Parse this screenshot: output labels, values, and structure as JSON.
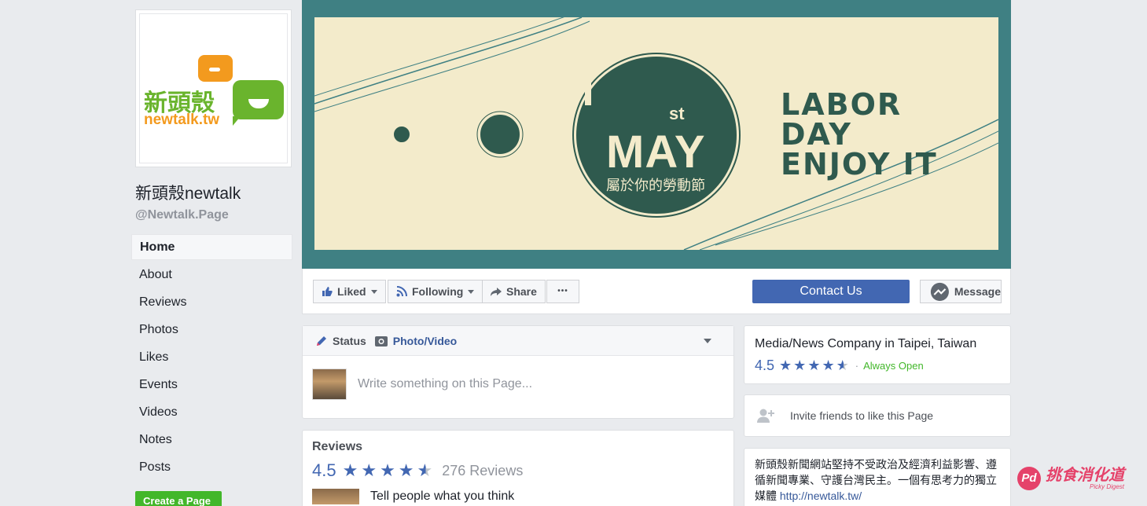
{
  "page": {
    "name": "新頭殼newtalk",
    "handle": "@Newtalk.Page",
    "logo_zh": "新頭殼",
    "logo_en": "newtalk.tw"
  },
  "nav": {
    "items": [
      {
        "label": "Home"
      },
      {
        "label": "About"
      },
      {
        "label": "Reviews"
      },
      {
        "label": "Photos"
      },
      {
        "label": "Likes"
      },
      {
        "label": "Events"
      },
      {
        "label": "Videos"
      },
      {
        "label": "Notes"
      },
      {
        "label": "Posts"
      }
    ],
    "create_page": "Create a Page"
  },
  "cover": {
    "st": "st",
    "may": "MAY",
    "zh": "屬於你的勞動節",
    "line1": "LABOR",
    "line2": "DAY",
    "line3": "ENJOY IT"
  },
  "actions": {
    "liked": "Liked",
    "following": "Following",
    "share": "Share",
    "more": "•••",
    "contact": "Contact Us",
    "message": "Message"
  },
  "composer": {
    "status": "Status",
    "photo": "Photo/Video",
    "placeholder": "Write something on this Page..."
  },
  "reviews": {
    "title": "Reviews",
    "rating": "4.5",
    "count": "276 Reviews",
    "prompt": "Tell people what you think"
  },
  "about": {
    "category": "Media/News Company in Taipei, Taiwan",
    "rating": "4.5",
    "separator": "·",
    "open": "Always Open",
    "invite": "Invite friends to like this Page",
    "description": "新頭殼新聞網站堅持不受政治及經濟利益影響、遵循新聞專業、守護台灣民主。一個有思考力的獨立媒體",
    "link": "http://newtalk.tw/"
  },
  "watermark": {
    "icon": "Pd",
    "text": "挑食消化道",
    "sub": "Picky Digest"
  },
  "colors": {
    "brand_blue": "#4267b2",
    "green": "#42b72a",
    "cover_teal": "#3f8083",
    "cover_cream": "#f3ebcb"
  }
}
